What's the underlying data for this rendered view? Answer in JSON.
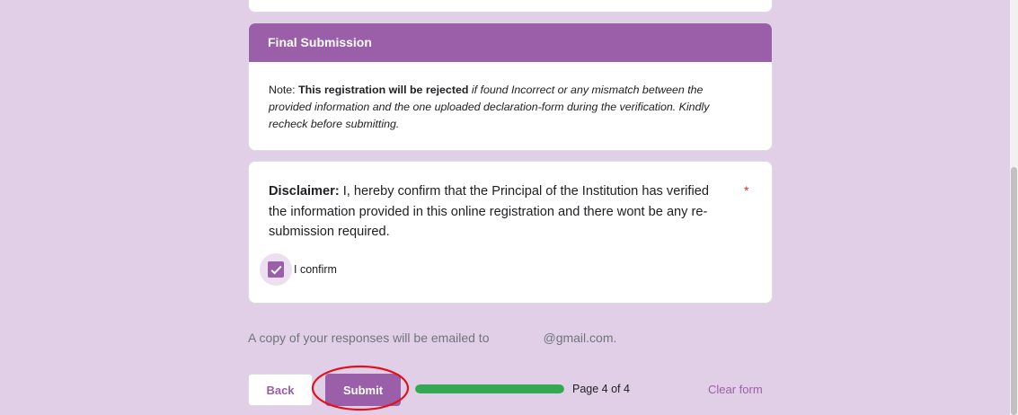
{
  "section": {
    "title": "Final Submission",
    "note_prefix": "Note: ",
    "note_bold": "This registration will be rejected",
    "note_italic": " if found Incorrect or any mismatch between the provided information and the one uploaded declaration-form during the verification. Kindly recheck before submitting."
  },
  "question": {
    "label_bold": "Disclaimer:",
    "label_text": " I, hereby confirm that the Principal of the Institution has verified the information provided in this online registration and there wont be any re-submission required.",
    "required_mark": "*",
    "option_label": "I confirm",
    "option_checked": true
  },
  "footer": {
    "email_prefix": "A copy of your responses will be emailed to",
    "email_domain": "@gmail.com.",
    "back_label": "Back",
    "submit_label": "Submit",
    "progress_fraction": 1.0,
    "page_indicator": "Page 4 of 4",
    "clear_label": "Clear form"
  },
  "colors": {
    "theme": "#9a5fa8",
    "background": "#e1cfe8",
    "progress": "#34a853",
    "annotation": "#e0131b"
  }
}
